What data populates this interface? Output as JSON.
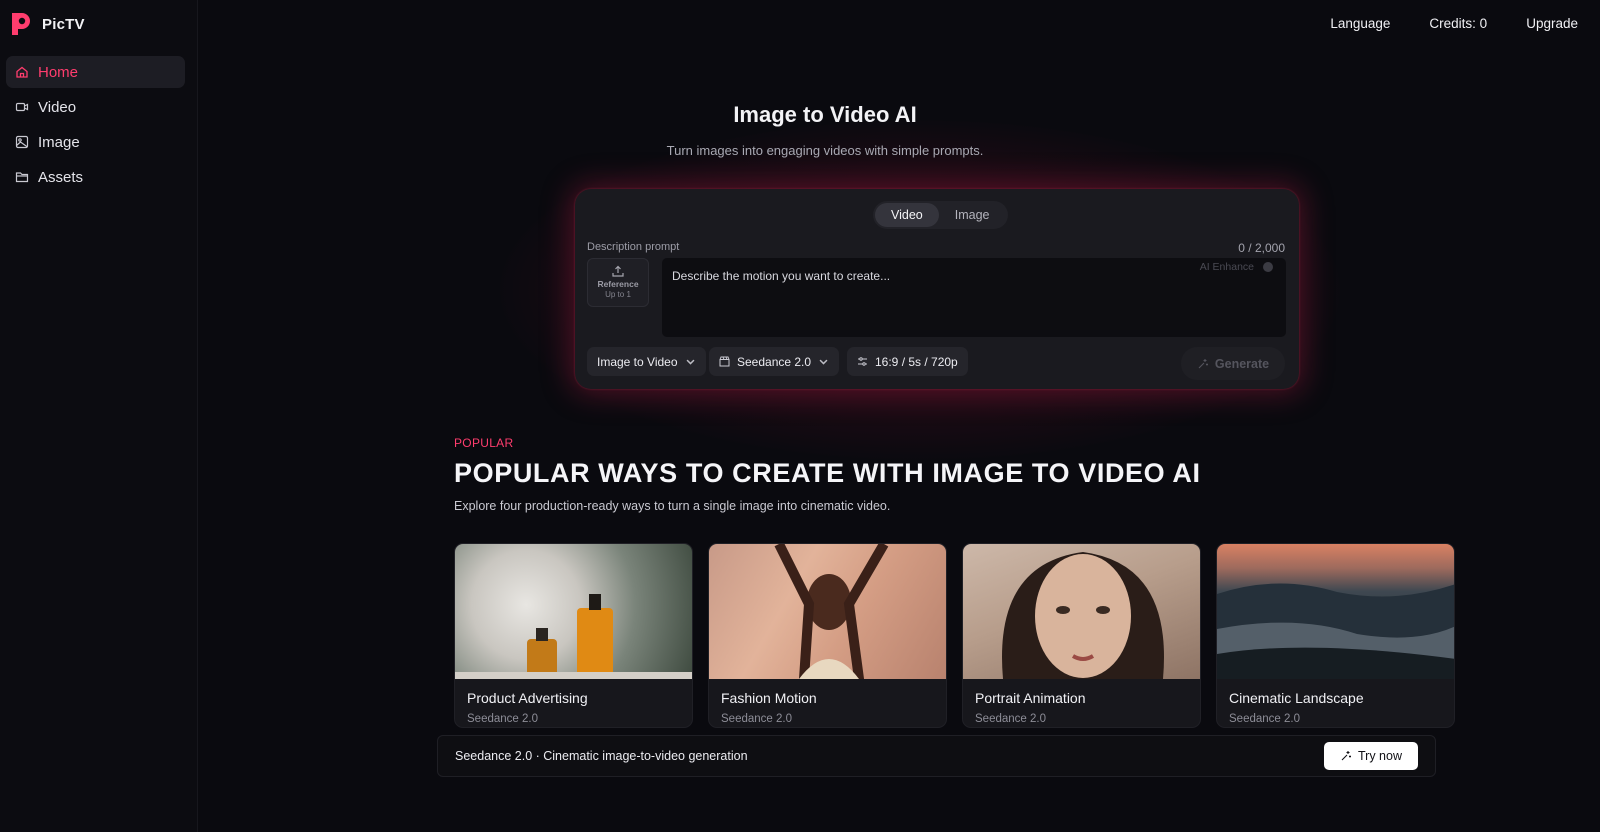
{
  "app": {
    "name": "PicTV",
    "brand_color": "#ff3d6e"
  },
  "topbar": {
    "language": "Language",
    "credits": "Credits: 0",
    "upgrade": "Upgrade"
  },
  "sidebar": {
    "items": [
      {
        "label": "Home",
        "icon": "home-icon",
        "active": true
      },
      {
        "label": "Video",
        "icon": "video-icon",
        "active": false
      },
      {
        "label": "Image",
        "icon": "image-icon",
        "active": false
      },
      {
        "label": "Assets",
        "icon": "folder-icon",
        "active": false
      }
    ]
  },
  "hero": {
    "title": "Image to Video AI",
    "subtitle": "Turn images into engaging videos with simple prompts."
  },
  "composer": {
    "tabs": [
      {
        "label": "Video",
        "active": true
      },
      {
        "label": "Image",
        "active": false
      }
    ],
    "prompt_label": "Description prompt",
    "counter": "0 / 2,000",
    "reference_label": "Reference",
    "reference_sub": "Up to 1",
    "placeholder": "Describe the motion you want to create...",
    "ai_enhance": "AI Enhance",
    "mode": "Image to Video",
    "model": "Seedance 2.0",
    "settings": "16:9 / 5s / 720p",
    "generate": "Generate"
  },
  "popular": {
    "eyebrow": "POPULAR",
    "title": "POPULAR WAYS TO CREATE WITH IMAGE TO VIDEO AI",
    "subtitle": "Explore four production-ready ways to turn a single image into cinematic video.",
    "cards": [
      {
        "title": "Product Advertising",
        "model": "Seedance 2.0"
      },
      {
        "title": "Fashion Motion",
        "model": "Seedance 2.0"
      },
      {
        "title": "Portrait Animation",
        "model": "Seedance 2.0"
      },
      {
        "title": "Cinematic Landscape",
        "model": "Seedance 2.0"
      }
    ]
  },
  "banner": {
    "text": "Seedance 2.0 · Cinematic image-to-video generation",
    "button": "Try now"
  }
}
